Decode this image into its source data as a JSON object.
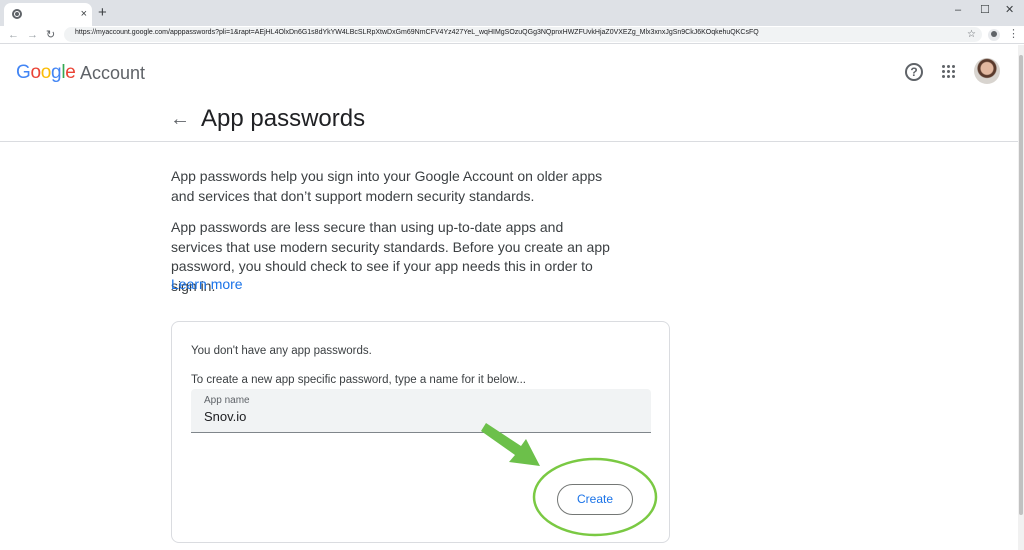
{
  "browser": {
    "tab_close": "×",
    "new_tab": "+",
    "url": "https://myaccount.google.com/apppasswords?pli=1&rapt=AEjHL4OlxDn6G1s8dYkYW4LBcSLRpXtwDxGm69NmCFV4Yz427YeL_wqHIMgSOzuQGg3NQpnxHWZFUvkHjaZ0VXEZg_Mlx3xnxJgSn9CkJ6KOqkehuQKCsFQ",
    "window_controls": [
      "–",
      "☐",
      "✕"
    ]
  },
  "header": {
    "logo_letters": [
      "G",
      "o",
      "o",
      "g",
      "l",
      "e"
    ],
    "logo_suffix": "Account",
    "help_glyph": "?"
  },
  "page": {
    "title": "App passwords",
    "back_glyph": "←",
    "intro": "App passwords help you sign into your Google Account on older apps and services that don’t support modern security standards.",
    "warning": "App passwords are less secure than using up-to-date apps and services that use modern security standards. Before you create an app password, you should check to see if your app needs this in order to sign in.",
    "learn_more": "Learn more"
  },
  "card": {
    "empty_text": "You don't have any app passwords.",
    "hint": "To create a new app specific password, type a name for it below...",
    "field_label": "App name",
    "field_value": "Snov.io",
    "create_label": "Create"
  },
  "annotation": {
    "arrow_color": "#6cc04a",
    "circle_color": "#7ac943"
  }
}
